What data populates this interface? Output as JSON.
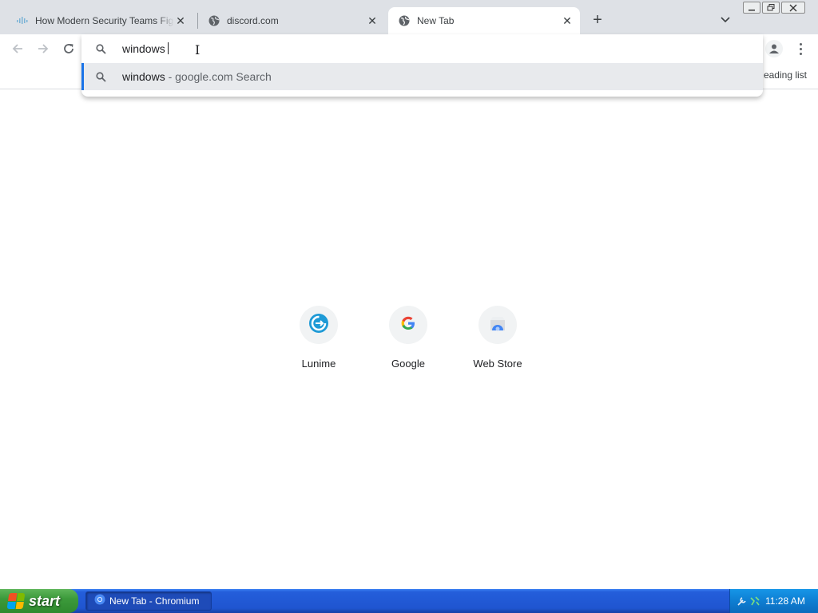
{
  "window": {
    "title": "New Tab - Chromium"
  },
  "tabs": [
    {
      "title": "How Modern Security Teams Fight",
      "icon": "site-favicon-icon",
      "active": false
    },
    {
      "title": "discord.com",
      "icon": "globe-icon",
      "active": false
    },
    {
      "title": "New Tab",
      "icon": "globe-icon",
      "active": true
    }
  ],
  "toolbar": {
    "back_icon": "back-arrow-icon",
    "forward_icon": "forward-arrow-icon",
    "reload_icon": "reload-icon",
    "reading_list_label": "Reading list"
  },
  "omnibox": {
    "value": "windows",
    "suggestions": [
      {
        "query": "windows",
        "source": " - google.com Search",
        "icon": "search-icon"
      }
    ]
  },
  "shortcuts": [
    {
      "label": "Lunime",
      "icon": "lunime-icon"
    },
    {
      "label": "Google",
      "icon": "google-g-icon"
    },
    {
      "label": "Web Store",
      "icon": "web-store-icon"
    }
  ],
  "taskbar": {
    "start_label": "start",
    "task_label": "New Tab - Chromium",
    "clock": "11:28 AM"
  },
  "colors": {
    "accent": "#1a73e8",
    "tabstrip": "#dee1e6",
    "taskbar": "#245edb",
    "start_button": "#3c9a3b"
  }
}
